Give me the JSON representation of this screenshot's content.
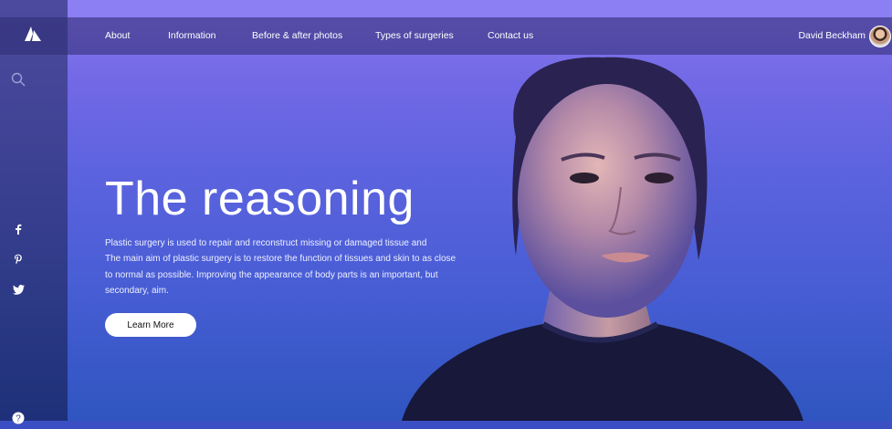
{
  "brand": {
    "logo_icon": "mountain-logo-icon"
  },
  "sidebar": {
    "search_icon": "search-icon",
    "social": [
      "facebook-icon",
      "pinterest-icon",
      "twitter-icon"
    ],
    "help_icon": "help-icon"
  },
  "nav": {
    "items": [
      {
        "label": "About"
      },
      {
        "label": "Information"
      },
      {
        "label": "Before & after photos"
      },
      {
        "label": "Types of surgeries"
      },
      {
        "label": "Contact us"
      }
    ],
    "user_name": "David Beckham"
  },
  "hero": {
    "title": "The reasoning",
    "paragraph": [
      "Plastic surgery is used to repair and reconstruct missing or damaged tissue and",
      "The main aim of plastic surgery is to restore the function of tissues and skin to as close",
      "to normal as possible. Improving the appearance of body parts is an important, but",
      "secondary, aim."
    ],
    "button_label": "Learn More"
  },
  "colors": {
    "top_strip": "#8c7ff4",
    "gradient_top": "#7469e6",
    "gradient_bottom": "#2f55c0",
    "sidebar": "#3f4294",
    "button_bg": "#ffffff"
  }
}
